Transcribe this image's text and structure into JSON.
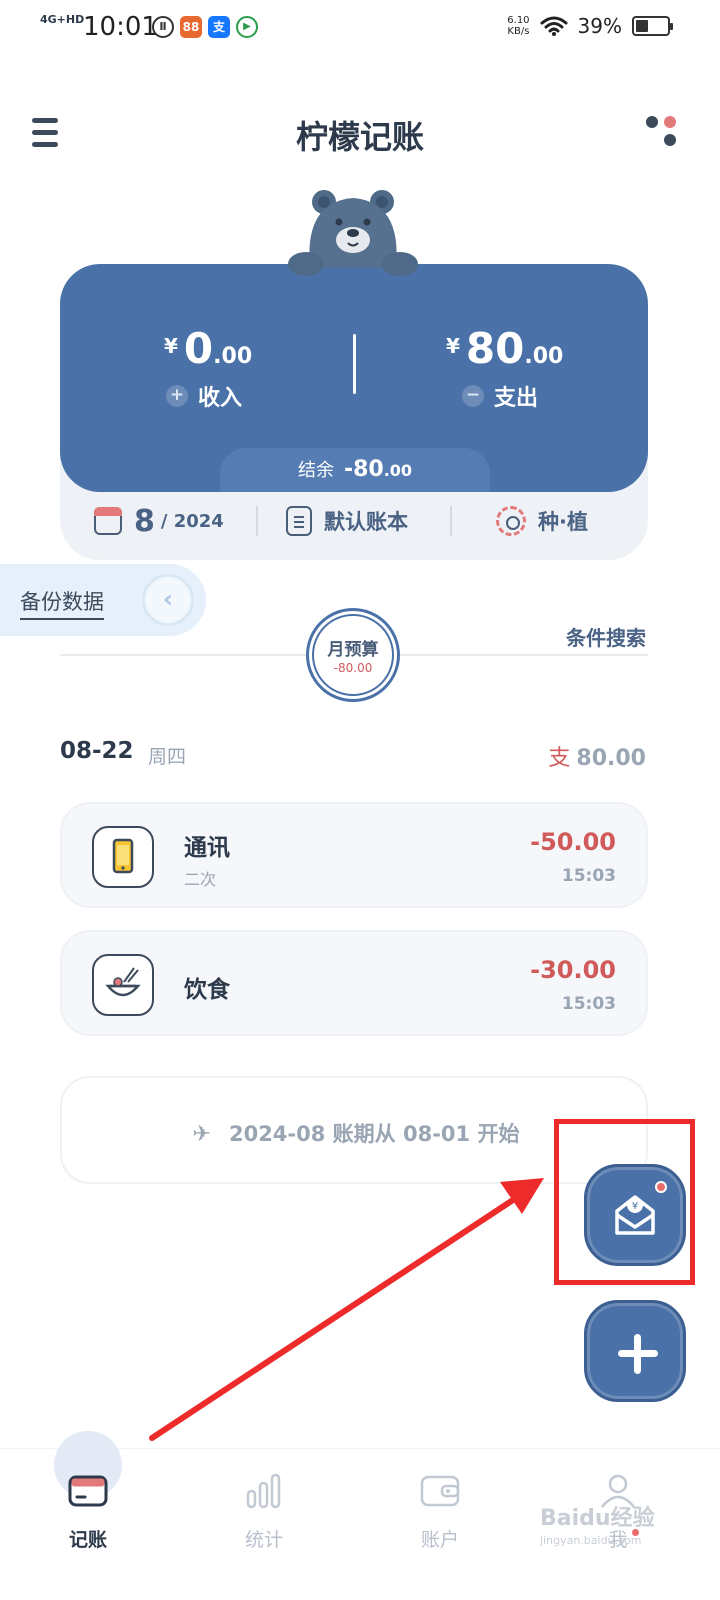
{
  "status_bar": {
    "network": "4G+HD",
    "time": "10:01",
    "speed_value": "6.10",
    "speed_unit": "KB/s",
    "battery_percent": "39%",
    "battery_level": 0.39
  },
  "header": {
    "title": "柠檬记账"
  },
  "summary": {
    "income": {
      "yen": "¥",
      "int": "0",
      "dec": ".00",
      "label": "收入",
      "symbol": "+"
    },
    "expense": {
      "yen": "¥",
      "int": "80",
      "dec": ".00",
      "label": "支出",
      "symbol": "−"
    },
    "balance": {
      "label": "结余",
      "int": "-80",
      "dec": ".00"
    },
    "month": "8",
    "year": "/ 2024",
    "book": "默认账本",
    "plant": "种·植"
  },
  "backup": {
    "label": "备份数据",
    "arrow": "‹"
  },
  "budget": {
    "title": "月预算",
    "value": "-80.00"
  },
  "search": "条件搜索",
  "day": {
    "date": "08-22",
    "weekday": "周四",
    "total_prefix": "支",
    "total": "80.00"
  },
  "transactions": [
    {
      "category": "通讯",
      "note": "二次",
      "amount": "-50.00",
      "time": "15:03",
      "icon": "phone-icon"
    },
    {
      "category": "饮食",
      "note": "",
      "amount": "-30.00",
      "time": "15:03",
      "icon": "bowl-icon"
    }
  ],
  "period": {
    "icon": "plane-icon",
    "text": "2024-08 账期从 08-01 开始"
  },
  "nav": {
    "items": [
      {
        "label": "记账",
        "icon": "card-icon"
      },
      {
        "label": "统计",
        "icon": "bar-chart-icon"
      },
      {
        "label": "账户",
        "icon": "wallet-icon"
      },
      {
        "label": "我",
        "icon": "person-icon"
      }
    ]
  },
  "watermark": {
    "text": "Baidu经验",
    "sub": "jingyan.baidu.com"
  },
  "colors": {
    "brand_blue": "#4a72a8",
    "expense_red": "#d05a5a",
    "annotation_red": "#ee2b2b"
  }
}
